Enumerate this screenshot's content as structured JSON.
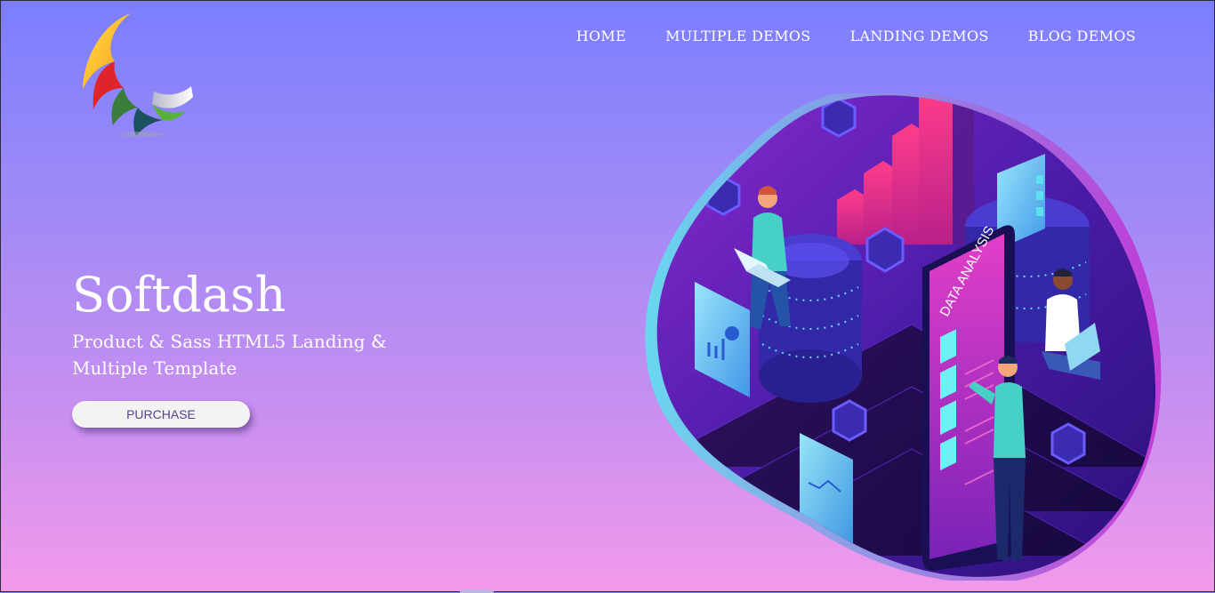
{
  "header": {
    "logo_icon": "rainbow-wave-logo",
    "nav": [
      {
        "label": "HOME"
      },
      {
        "label": "MULTIPLE DEMOS"
      },
      {
        "label": "LANDING DEMOS"
      },
      {
        "label": "BLOG DEMOS"
      }
    ]
  },
  "hero": {
    "title": "Softdash",
    "subtitle": "Product & Sass HTML5 Landing & Multiple Template",
    "button_label": "PURCHASE"
  },
  "illustration": {
    "phone_text": "DATA ANALYSIS"
  },
  "colors": {
    "background_top": "#7b7eff",
    "background_bottom": "#f39aeb",
    "blob_dark": "#3a1a9a",
    "blob_magenta": "#c22ad0",
    "accent_cyan": "#5fe0ee",
    "accent_pink": "#f03b8f"
  }
}
